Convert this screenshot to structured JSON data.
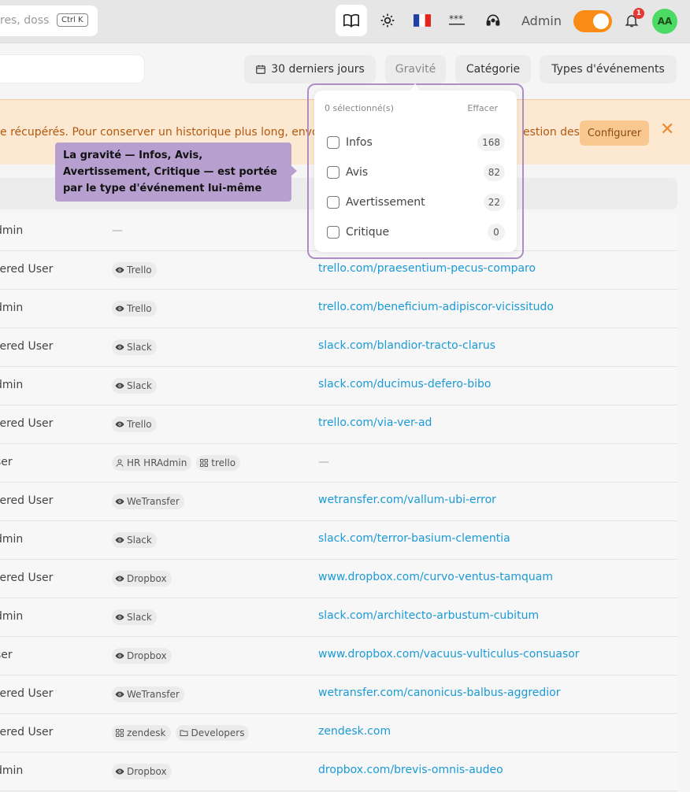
{
  "topbar": {
    "search_placeholder": "res, doss",
    "search_shortcut": "Ctrl K",
    "admin_label": "Admin",
    "notification_count": "1",
    "avatar_initials": "AA",
    "toggle_state": "on",
    "accent_color": "#fa8c16"
  },
  "filters": {
    "date_range": "30 derniers jours",
    "severity": "Gravité",
    "category": "Catégorie",
    "event_types": "Types d'événements"
  },
  "banner": {
    "text": "e récupérés. Pour conserver un historique plus long, envo",
    "text_right": "estion des",
    "configure_label": "Configurer",
    "close_symbol": "✕"
  },
  "dropdown": {
    "selected_count_text": "0 sélectionné(s)",
    "clear_label": "Effacer",
    "items": [
      {
        "label": "Infos",
        "count": "168"
      },
      {
        "label": "Avis",
        "count": "82"
      },
      {
        "label": "Avertissement",
        "count": "22"
      },
      {
        "label": "Critique",
        "count": "0"
      }
    ]
  },
  "callout": {
    "text": "La gravité — Infos, Avis, Avertissement, Critique — est portée par le type d'événement lui-même"
  },
  "rows": [
    {
      "user": "dmin",
      "tags": [],
      "link": "",
      "dash_mid": "—",
      "dash_link": ""
    },
    {
      "user": "tered User",
      "tags": [
        {
          "icon": "eye-icon",
          "text": "Trello"
        }
      ],
      "link": "trello.com/praesentium-pecus-comparo"
    },
    {
      "user": "dmin",
      "tags": [
        {
          "icon": "eye-icon",
          "text": "Trello"
        }
      ],
      "link": "trello.com/beneficium-adipiscor-vicissitudo"
    },
    {
      "user": "tered User",
      "tags": [
        {
          "icon": "eye-icon",
          "text": "Slack"
        }
      ],
      "link": "slack.com/blandior-tracto-clarus"
    },
    {
      "user": "dmin",
      "tags": [
        {
          "icon": "eye-icon",
          "text": "Slack"
        }
      ],
      "link": "slack.com/ducimus-defero-bibo"
    },
    {
      "user": "tered User",
      "tags": [
        {
          "icon": "eye-icon",
          "text": "Trello"
        }
      ],
      "link": "trello.com/via-ver-ad"
    },
    {
      "user": "ser",
      "tags": [
        {
          "icon": "user-icon",
          "text": "HR HRAdmin"
        },
        {
          "icon": "apps-icon",
          "text": "trello"
        }
      ],
      "link": "",
      "dash_link": "—"
    },
    {
      "user": "tered User",
      "tags": [
        {
          "icon": "eye-icon",
          "text": "WeTransfer"
        }
      ],
      "link": "wetransfer.com/vallum-ubi-error"
    },
    {
      "user": "dmin",
      "tags": [
        {
          "icon": "eye-icon",
          "text": "Slack"
        }
      ],
      "link": "slack.com/terror-basium-clementia"
    },
    {
      "user": "tered User",
      "tags": [
        {
          "icon": "eye-icon",
          "text": "Dropbox"
        }
      ],
      "link": "www.dropbox.com/curvo-ventus-tamquam"
    },
    {
      "user": "dmin",
      "tags": [
        {
          "icon": "eye-icon",
          "text": "Slack"
        }
      ],
      "link": "slack.com/architecto-arbustum-cubitum"
    },
    {
      "user": "ser",
      "tags": [
        {
          "icon": "eye-icon",
          "text": "Dropbox"
        }
      ],
      "link": "www.dropbox.com/vacuus-vulticulus-consuasor"
    },
    {
      "user": "tered User",
      "tags": [
        {
          "icon": "eye-icon",
          "text": "WeTransfer"
        }
      ],
      "link": "wetransfer.com/canonicus-balbus-aggredior"
    },
    {
      "user": "tered User",
      "tags": [
        {
          "icon": "apps-icon",
          "text": "zendesk"
        },
        {
          "icon": "folder-icon",
          "text": "Developers"
        }
      ],
      "link": "zendesk.com"
    },
    {
      "user": "dmin",
      "tags": [
        {
          "icon": "eye-icon",
          "text": "Dropbox"
        }
      ],
      "link": "dropbox.com/brevis-omnis-audeo"
    }
  ]
}
